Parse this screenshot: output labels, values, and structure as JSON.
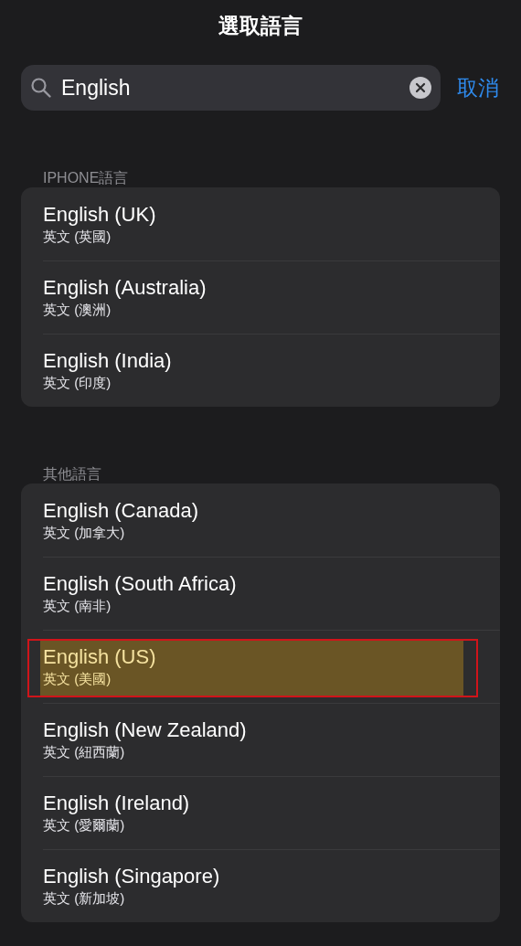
{
  "title": "選取語言",
  "search": {
    "value": "English",
    "cancel": "取消"
  },
  "sections": [
    {
      "header": "IPHONE語言",
      "items": [
        {
          "name": "English (UK)",
          "native": "英文 (英國)",
          "highlighted": false
        },
        {
          "name": "English (Australia)",
          "native": "英文 (澳洲)",
          "highlighted": false
        },
        {
          "name": "English (India)",
          "native": "英文 (印度)",
          "highlighted": false
        }
      ]
    },
    {
      "header": "其他語言",
      "items": [
        {
          "name": "English (Canada)",
          "native": "英文 (加拿大)",
          "highlighted": false
        },
        {
          "name": "English (South Africa)",
          "native": "英文 (南非)",
          "highlighted": false
        },
        {
          "name": "English (US)",
          "native": "英文 (美國)",
          "highlighted": true
        },
        {
          "name": "English (New Zealand)",
          "native": "英文 (紐西蘭)",
          "highlighted": false
        },
        {
          "name": "English (Ireland)",
          "native": "英文 (愛爾蘭)",
          "highlighted": false
        },
        {
          "name": "English (Singapore)",
          "native": "英文 (新加坡)",
          "highlighted": false
        }
      ]
    }
  ]
}
